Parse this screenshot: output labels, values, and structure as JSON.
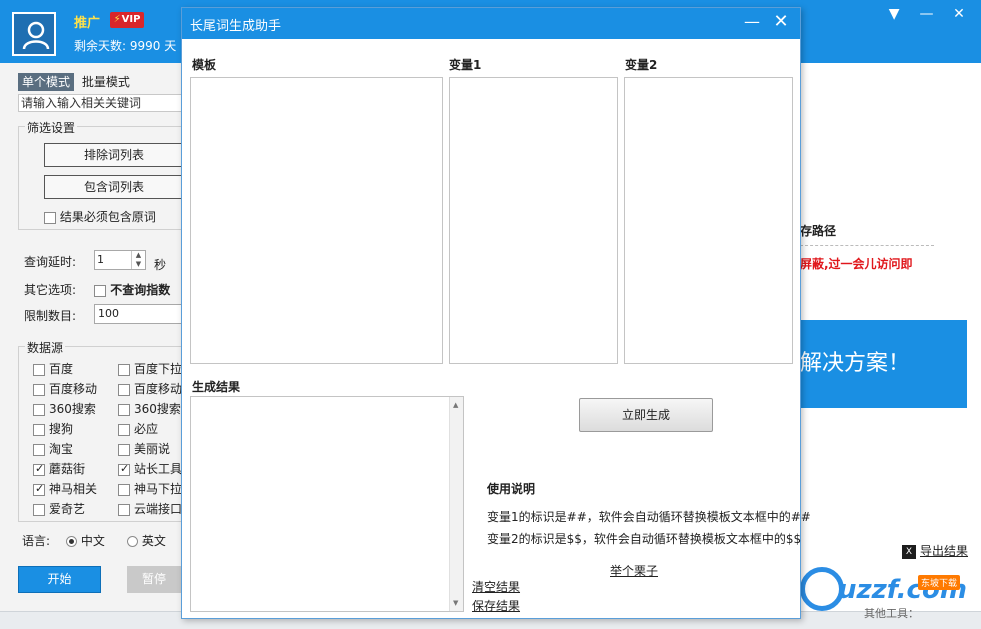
{
  "main": {
    "promo_label": "推广",
    "vip": "VIP",
    "days_left": "剩余天数: 9990 天",
    "controls": [
      "▼",
      "—",
      "✕"
    ]
  },
  "left": {
    "tabs": [
      {
        "label": "单个模式",
        "active": true
      },
      {
        "label": "批量模式",
        "active": false
      }
    ],
    "keyword_placeholder": "请输入输入相关关键词",
    "filter_group": "筛选设置",
    "exclude_btn": "排除词列表",
    "include_btn": "包含词列表",
    "must_contain": {
      "label": "结果必须包含原词",
      "checked": false
    },
    "query_delay_label": "查询延时:",
    "query_delay_value": "1",
    "seconds": "秒",
    "other_options_label": "其它选项:",
    "no_index": {
      "label": "不查询指数",
      "checked": false
    },
    "limit_label": "限制数目:",
    "limit_value": "100",
    "datasource_group": "数据源",
    "sources": [
      {
        "label": "百度",
        "checked": false
      },
      {
        "label": "百度下拉",
        "checked": false
      },
      {
        "label": "百度移动",
        "checked": false
      },
      {
        "label": "百度移动",
        "checked": false
      },
      {
        "label": "360搜索",
        "checked": false
      },
      {
        "label": "360搜索",
        "checked": false
      },
      {
        "label": "搜狗",
        "checked": false
      },
      {
        "label": "必应",
        "checked": false
      },
      {
        "label": "淘宝",
        "checked": false
      },
      {
        "label": "美丽说",
        "checked": false
      },
      {
        "label": "蘑菇街",
        "checked": true
      },
      {
        "label": "站长工具",
        "checked": true
      },
      {
        "label": "神马相关",
        "checked": true
      },
      {
        "label": "神马下拉",
        "checked": false
      },
      {
        "label": "爱奇艺",
        "checked": false
      },
      {
        "label": "云端接口",
        "checked": false
      }
    ],
    "language_label": "语言:",
    "lang_cn": "中文",
    "lang_en": "英文",
    "start_btn": "开始",
    "pause_btn": "暂停"
  },
  "right": {
    "save_path": "存路径",
    "blocked_msg": "屏蔽,过一会儿访问即",
    "banner": "解决方案！",
    "export": "导出结果"
  },
  "watermark": {
    "text": "uzzf.com",
    "badge": "东坡下载",
    "sub": "其他工具："
  },
  "dialog": {
    "title": "长尾词生成助手",
    "template_label": "模板",
    "var1_label": "变量1",
    "var2_label": "变量2",
    "result_label": "生成结果",
    "generate_btn": "立即生成",
    "usage_title": "使用说明",
    "usage_1": "变量1的标识是##，软件会自动循环替换模板文本框中的##",
    "usage_2": "变量2的标识是$$，软件会自动循环替换模板文本框中的$$",
    "example_link": "举个栗子",
    "clear_link": "清空结果",
    "save_link": "保存结果"
  }
}
